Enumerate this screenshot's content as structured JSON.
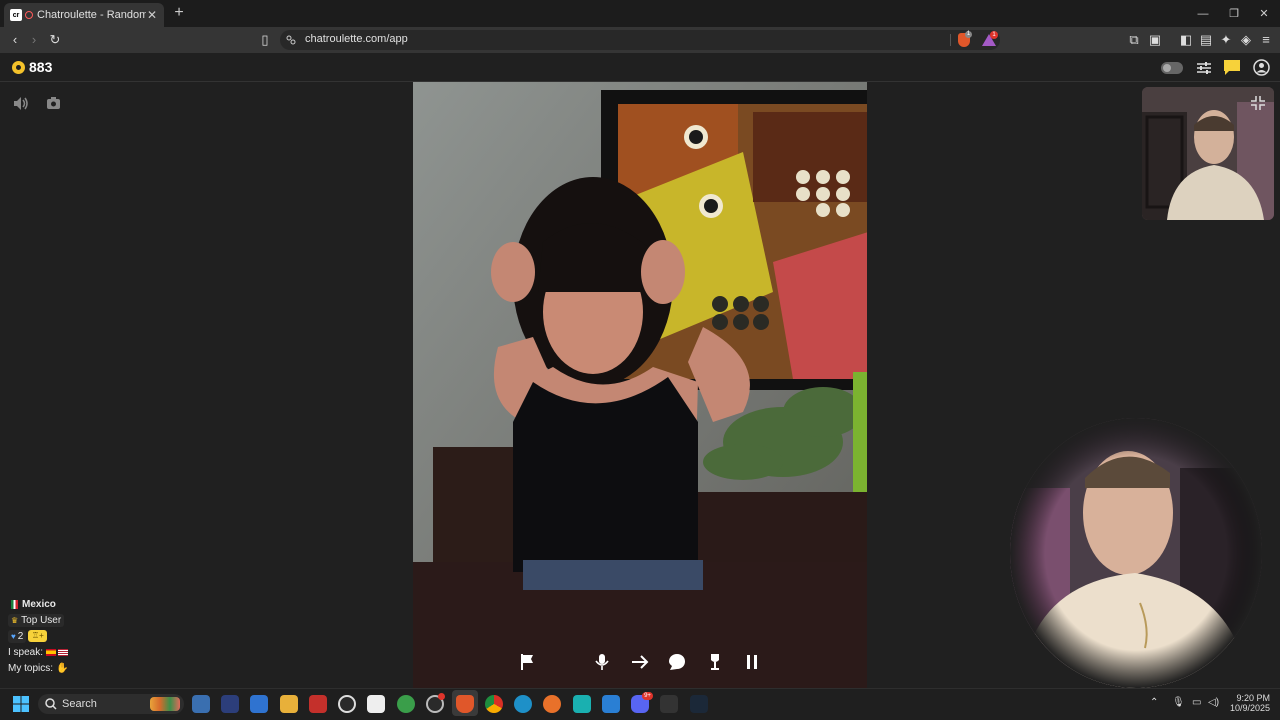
{
  "browser": {
    "tab_title": "Chatroulette - Random video",
    "url": "chatroulette.com/app",
    "extension_badge_1": "1",
    "extension_badge_2": "1"
  },
  "header": {
    "coins": "883"
  },
  "partner": {
    "country": "Mexico",
    "badge": "Top User",
    "level": "2",
    "speak_label": "I speak:",
    "topics_label": "My topics:"
  },
  "taskbar": {
    "search_placeholder": "Search",
    "time": "9:20 PM",
    "date": "10/9/2025",
    "badge_discord": "9+"
  },
  "colors": {
    "background": "#202020",
    "coin": "#f4c22b",
    "chat_icon": "#f7d23a"
  },
  "icons": [
    "speaker-icon",
    "camera-icon",
    "flag-icon",
    "mic-icon",
    "next-arrow-icon",
    "chat-bubble-icon",
    "trophy-icon",
    "pause-icon",
    "filters-icon",
    "account-icon",
    "exit-fullscreen-icon",
    "windows-start-icon"
  ]
}
